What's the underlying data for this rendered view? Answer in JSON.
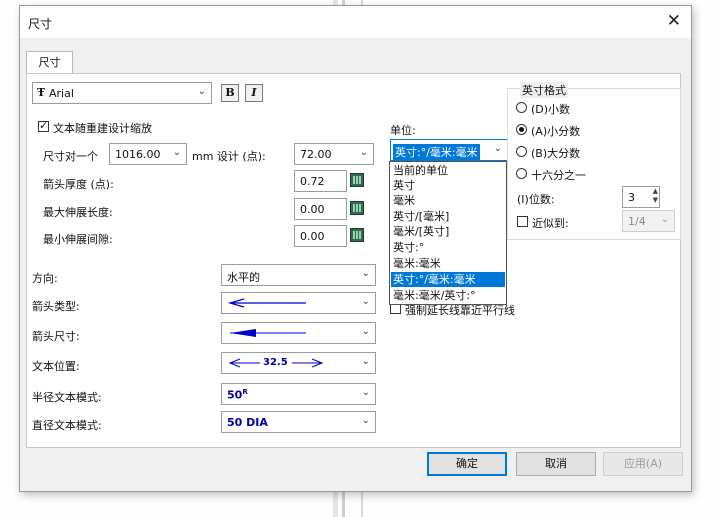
{
  "window": {
    "title": "尺寸",
    "tab_label": "尺寸"
  },
  "font": {
    "selected": "Arial",
    "bold_label": "B",
    "italic_label": "I"
  },
  "scale_with_design": {
    "label": "文本随重建设计缩放",
    "checked": true
  },
  "size_row": {
    "label": "尺寸对一个",
    "value": "1016.00",
    "mm_label": "mm 设计 (点):",
    "design_value": "72.00"
  },
  "arrow_thickness": {
    "label": "箭头厚度 (点):",
    "value": "0.72"
  },
  "max_extension": {
    "label": "最大伸展长度:",
    "value": "0.00"
  },
  "min_gap": {
    "label": "最小伸展间隙:",
    "value": "0.00"
  },
  "direction": {
    "label": "方向:",
    "value": "水平的"
  },
  "arrow_type": {
    "label": "箭头类型:"
  },
  "arrow_size": {
    "label": "箭头尺寸:"
  },
  "text_position": {
    "label": "文本位置:",
    "sample": "32.5"
  },
  "radius_mode": {
    "label": "半径文本模式:",
    "value": "50",
    "superscript": "R"
  },
  "diameter_mode": {
    "label": "直径文本模式:",
    "value": "50 DIA"
  },
  "units": {
    "label": "单位:",
    "selected": "英寸:°/毫米:毫米",
    "options": [
      "当前的单位",
      "英寸",
      "毫米",
      "英寸/[毫米]",
      "毫米/[英寸]",
      "英寸:°",
      "毫米:毫米",
      "英寸:°/毫米:毫米",
      "毫米:毫米/英寸:°"
    ],
    "selected_index": 7
  },
  "hidden_checkbox_label": "强制延长线靠近平行线",
  "format": {
    "title": "英寸格式",
    "options": [
      "(D)小数",
      "(A)小分数",
      "(B)大分数",
      "十六分之一"
    ],
    "selected_index": 1,
    "digits_label": "(I)位数:",
    "digits_value": "3",
    "approx_label": "近似到:",
    "approx_value": "1/4"
  },
  "buttons": {
    "ok": "确定",
    "cancel": "取消",
    "apply": "应用(A)"
  }
}
